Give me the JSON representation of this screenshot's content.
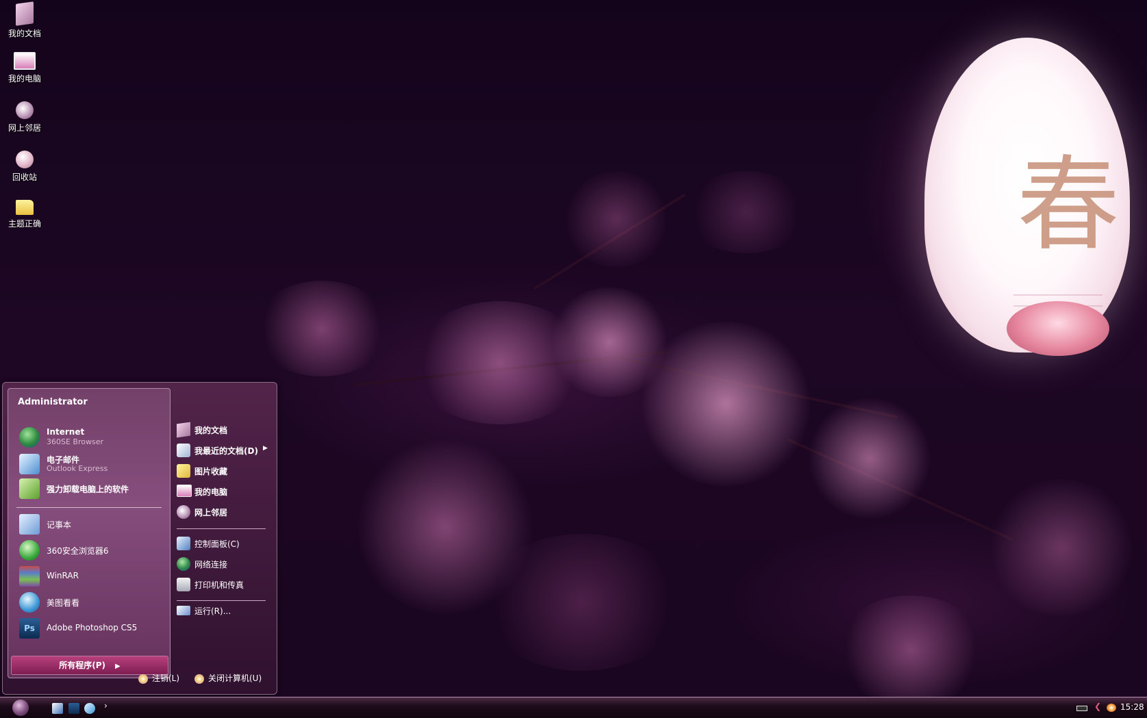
{
  "desktop_icons": [
    {
      "label": "我的文档",
      "icon": "documents-icon"
    },
    {
      "label": "我的电脑",
      "icon": "computer-icon"
    },
    {
      "label": "网上邻居",
      "icon": "network-icon"
    },
    {
      "label": "回收站",
      "icon": "recycle-bin-icon"
    },
    {
      "label": "主题正确",
      "icon": "folder-icon"
    }
  ],
  "wallpaper": {
    "lantern_char": "春"
  },
  "start_menu": {
    "user": "Administrator",
    "pinned": [
      {
        "title": "Internet",
        "subtitle": "360SE Browser"
      },
      {
        "title": "电子邮件",
        "subtitle": "Outlook Express"
      },
      {
        "title": "强力卸载电脑上的软件"
      }
    ],
    "programs": [
      {
        "title": "记事本"
      },
      {
        "title": "360安全浏览器6"
      },
      {
        "title": "WinRAR"
      },
      {
        "title": "美图看看"
      },
      {
        "title": "Adobe Photoshop CS5"
      }
    ],
    "all_programs": "所有程序(P)",
    "right": {
      "group1": [
        {
          "label": "我的文档"
        },
        {
          "label": "我最近的文档(D)"
        },
        {
          "label": "图片收藏"
        },
        {
          "label": "我的电脑"
        },
        {
          "label": "网上邻居"
        }
      ],
      "group2": [
        {
          "label": "控制面板(C)"
        },
        {
          "label": "网络连接"
        },
        {
          "label": "打印机和传真"
        }
      ],
      "group3": [
        {
          "label": "运行(R)..."
        }
      ]
    },
    "logoff": "注销(L)",
    "shutdown": "关闭计算机(U)"
  },
  "taskbar": {
    "quicklaunch_more": "›",
    "clock": "15:28"
  },
  "colors": {
    "accent": "#b8407c",
    "menu_bg": "#5a2850",
    "wallpaper_bg": "#1a0620"
  }
}
